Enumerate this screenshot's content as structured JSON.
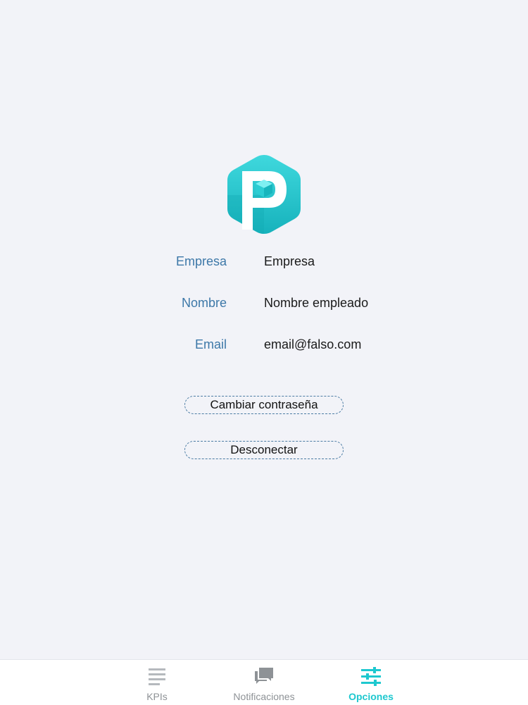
{
  "profile": {
    "fields": [
      {
        "label": "Empresa",
        "value": "Empresa"
      },
      {
        "label": "Nombre",
        "value": "Nombre empleado"
      },
      {
        "label": "Email",
        "value": "email@falso.com"
      }
    ]
  },
  "actions": {
    "change_password_label": "Cambiar contraseña",
    "disconnect_label": "Desconectar"
  },
  "tabbar": {
    "active_tab": "Opciones",
    "active_color": "#1ec8cf",
    "inactive_color": "#8e9296",
    "tabs": [
      {
        "label": "KPIs",
        "icon": "list-icon"
      },
      {
        "label": "Notificaciones",
        "icon": "chat-bubbles-icon"
      },
      {
        "label": "Opciones",
        "icon": "sliders-icon"
      }
    ]
  },
  "colors": {
    "background": "#f2f3f8",
    "label": "#3d78a8",
    "logo_teal": "#22c3c9"
  }
}
